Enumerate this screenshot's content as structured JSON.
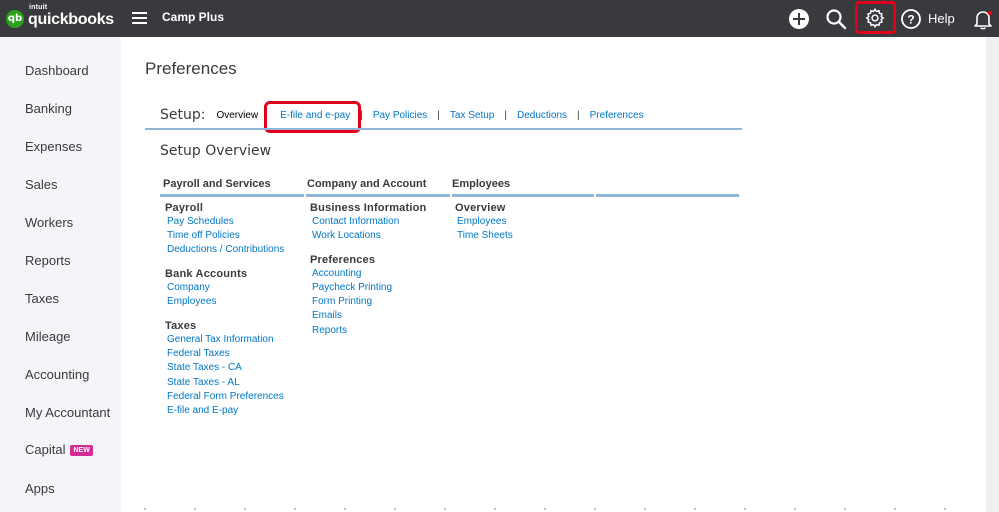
{
  "app": {
    "logo_intuit": "intuit",
    "logo_name": "quickbooks",
    "logo_glyph": "qb",
    "company": "Camp Plus",
    "help_label": "Help",
    "icons": [
      "plus-circle-icon",
      "search-icon",
      "gear-icon",
      "help-circle-icon",
      "bell-icon"
    ]
  },
  "sidebar": {
    "items": [
      {
        "label": "Dashboard"
      },
      {
        "label": "Banking"
      },
      {
        "label": "Expenses"
      },
      {
        "label": "Sales"
      },
      {
        "label": "Workers"
      },
      {
        "label": "Reports"
      },
      {
        "label": "Taxes"
      },
      {
        "label": "Mileage"
      },
      {
        "label": "Accounting"
      },
      {
        "label": "My Accountant"
      },
      {
        "label": "Capital",
        "badge": "NEW"
      },
      {
        "label": "Apps"
      }
    ]
  },
  "page": {
    "title": "Preferences",
    "setup_label": "Setup:",
    "current_tab": "Overview",
    "tabs": [
      "E-file and e-pay",
      "Pay Policies",
      "Tax Setup",
      "Deductions",
      "Preferences"
    ],
    "separator": "|",
    "section_title": "Setup Overview"
  },
  "columns": [
    {
      "header": "Payroll and Services",
      "groups": [
        {
          "title": "Payroll",
          "links": [
            "Pay Schedules",
            "Time off Policies",
            "Deductions / Contributions"
          ]
        },
        {
          "title": "Bank Accounts",
          "links": [
            "Company",
            "Employees"
          ]
        },
        {
          "title": "Taxes",
          "links": [
            "General Tax Information",
            "Federal Taxes",
            "State Taxes - CA",
            "State Taxes - AL",
            "Federal Form Preferences",
            "E-file and E-pay"
          ]
        }
      ]
    },
    {
      "header": "Company and Account",
      "groups": [
        {
          "title": "Business Information",
          "links": [
            "Contact Information",
            "Work Locations"
          ]
        },
        {
          "title": "Preferences",
          "links": [
            "Accounting",
            "Paycheck Printing",
            "Form Printing",
            "Emails",
            "Reports"
          ]
        }
      ]
    },
    {
      "header": "Employees",
      "groups": [
        {
          "title": "Overview",
          "links": [
            "Employees",
            "Time Sheets"
          ]
        }
      ]
    }
  ],
  "colors": {
    "topbar": "#393a3d",
    "accent_green": "#2ca01c",
    "link_blue": "#0077c5",
    "highlight_red": "#e0001b",
    "badge_pink": "#d52b94",
    "divider_blue": "#8fb6d6"
  }
}
